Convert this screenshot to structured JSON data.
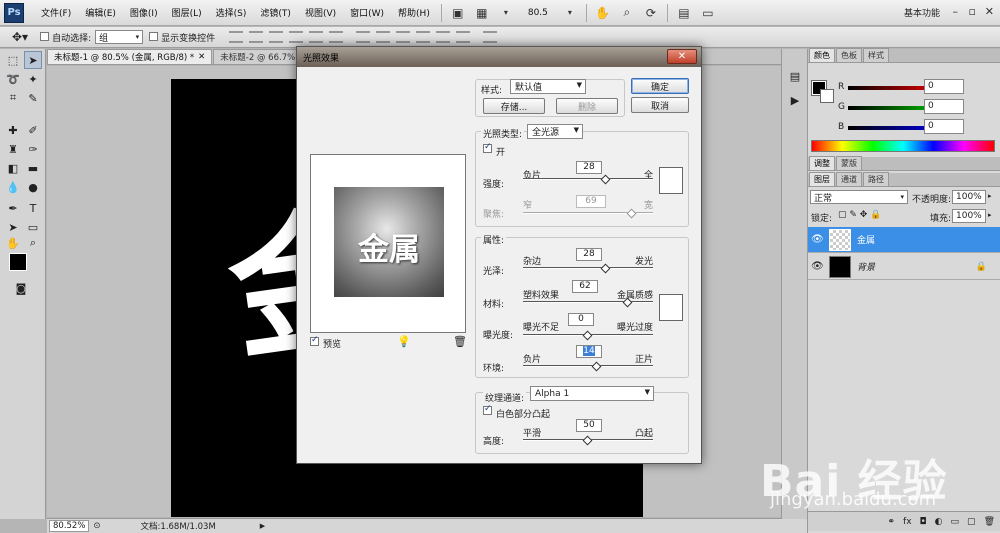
{
  "app": {
    "logo": "Ps"
  },
  "menu": {
    "items": [
      "文件(F)",
      "编辑(E)",
      "图像(I)",
      "图层(L)",
      "选择(S)",
      "滤镜(T)",
      "视图(V)",
      "窗口(W)",
      "帮助(H)"
    ],
    "zoom": "80.5",
    "workspace": "基本功能"
  },
  "options": {
    "auto_select_label": "自动选择:",
    "auto_select_value": "组",
    "show_transform_label": "显示变换控件"
  },
  "tabs": [
    {
      "label": "未标题-1 @ 80.5% (金属, RGB/8) *"
    },
    {
      "label": "未标题-2 @ 66.7% (图"
    }
  ],
  "canvas": {
    "glyph": "金"
  },
  "status": {
    "zoom": "80.52%",
    "doc": "文档:1.68M/1.03M"
  },
  "dialog": {
    "title": "光照效果",
    "style_label": "样式:",
    "style_value": "默认值",
    "save_label": "存储...",
    "delete_label": "删除",
    "ok_label": "确定",
    "cancel_label": "取消",
    "light_type_label": "光照类型:",
    "light_type_value": "全光源",
    "on_label": "开",
    "intensity": {
      "label": "强度:",
      "left": "负片",
      "right": "全",
      "value": "28",
      "fraction": 0.64
    },
    "focus": {
      "label": "聚焦:",
      "left": "窄",
      "right": "宽",
      "value": "69",
      "fraction": 0.84
    },
    "properties_label": "属性:",
    "gloss": {
      "label": "光泽:",
      "left": "杂边",
      "right": "发光",
      "value": "28",
      "fraction": 0.64
    },
    "material": {
      "label": "材料:",
      "left": "塑料效果",
      "right": "金属质感",
      "value": "62",
      "fraction": 0.81
    },
    "exposure": {
      "label": "曝光度:",
      "left": "曝光不足",
      "right": "曝光过度",
      "value": "0",
      "fraction": 0.5
    },
    "ambience": {
      "label": "环境:",
      "left": "负片",
      "right": "正片",
      "value": "14",
      "fraction": 0.57
    },
    "texture_label": "纹理通道:",
    "texture_value": "Alpha 1",
    "white_high_label": "白色部分凸起",
    "height": {
      "label": "高度:",
      "left": "平滑",
      "right": "凸起",
      "value": "50",
      "fraction": 0.5
    },
    "preview_label": "预览",
    "preview_text": "金属"
  },
  "color_panel": {
    "tabs": [
      "颜色",
      "色板",
      "样式"
    ],
    "r": "0",
    "g": "0",
    "b": "0"
  },
  "adjust_tabs": [
    "调整",
    "蒙版"
  ],
  "layers_panel": {
    "tabs": [
      "图层",
      "通道",
      "路径"
    ],
    "blend_mode": "正常",
    "opacity_label": "不透明度:",
    "opacity_value": "100%",
    "lock_label": "锁定:",
    "fill_label": "填充:",
    "fill_value": "100%",
    "layers": [
      {
        "name": "金属"
      },
      {
        "name": "背景"
      }
    ]
  },
  "watermark": {
    "brand": "Bai 经验",
    "url": "jingyan.baidu.com"
  },
  "colors": {
    "selection": "#3b8fe6",
    "dialog_bg": "#f0f0f0",
    "canvas_bg": "#000000"
  }
}
